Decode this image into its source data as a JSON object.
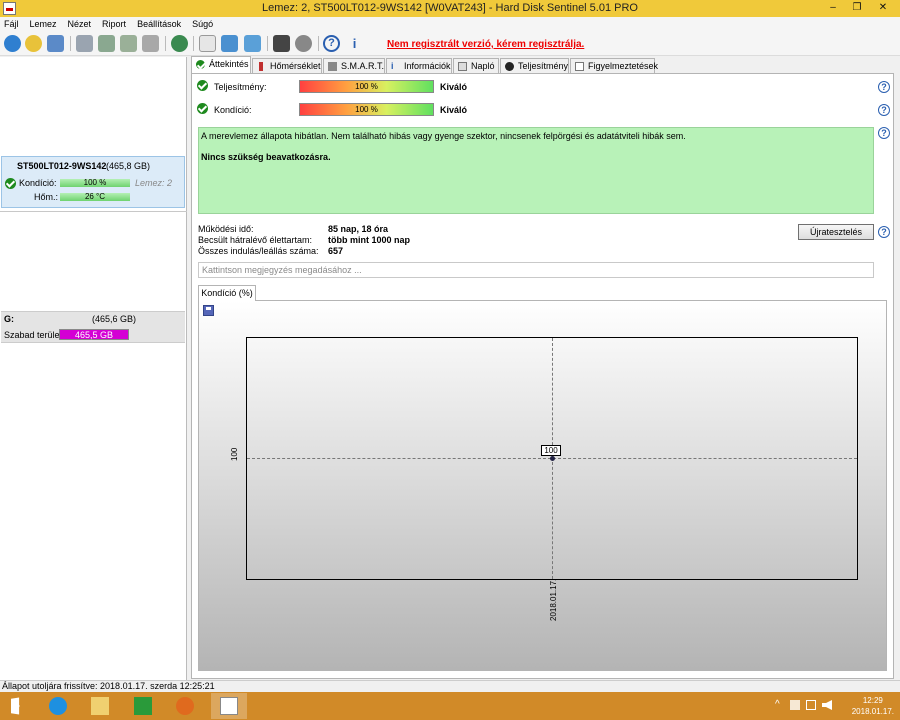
{
  "window": {
    "title": "Lemez: 2, ST500LT012-9WS142 [W0VAT243]  -  Hard Disk Sentinel 5.01 PRO",
    "minimize": "–",
    "maximize": "❐",
    "close": "✕"
  },
  "menu": [
    "Fájl",
    "Lemez",
    "Nézet",
    "Riport",
    "Beállítások",
    "Súgó"
  ],
  "toolbar": {
    "unregistered_link": "Nem regisztrált verzió, kérem regisztrálja."
  },
  "left": {
    "disk": {
      "name": "ST500LT012-9WS142",
      "size": "(465,8 GB)",
      "health_label": "Kondíció:",
      "health_value": "100 %",
      "health_fraction": 1.0,
      "disk_index": "Lemez: 2",
      "temp_label": "Hőm.:",
      "temp_value": "26 °C"
    },
    "volume": {
      "letter": "G:",
      "size": "(465,6 GB)",
      "free_label": "Szabad terület",
      "free_value": "465,5 GB",
      "free_color": "#d400d4"
    }
  },
  "tabs": [
    {
      "label": "Áttekintés",
      "icon": "check-icon"
    },
    {
      "label": "Hőmérséklet",
      "icon": "thermometer-icon"
    },
    {
      "label": "S.M.A.R.T.",
      "icon": "smart-icon"
    },
    {
      "label": "Információk",
      "icon": "info-icon"
    },
    {
      "label": "Napló",
      "icon": "log-icon"
    },
    {
      "label": "Teljesítmény",
      "icon": "performance-icon"
    },
    {
      "label": "Figyelmeztetések",
      "icon": "alerts-icon"
    }
  ],
  "overview": {
    "performance_label": "Teljesítmény:",
    "performance_value": "100 %",
    "performance_fraction": 1.0,
    "performance_status": "Kiváló",
    "health_label": "Kondíció:",
    "health_value": "100 %",
    "health_fraction": 1.0,
    "health_status": "Kiváló",
    "status_text": "A merevlemez állapota hibátlan. Nem található hibás vagy gyenge szektor, nincsenek felpörgési és adatátviteli hibák sem.",
    "status_action": "Nincs szükség beavatkozásra.",
    "uptime_label": "Működési idő:",
    "uptime_value": "85 nap, 18 óra",
    "lifetime_label": "Becsült hátralévő élettartam:",
    "lifetime_value": "több mint 1000 nap",
    "startstop_label": "Összes indulás/leállás száma:",
    "startstop_value": "657",
    "retest_button": "Újratesztelés",
    "notes_placeholder": "Kattintson megjegyzés megadásához ..."
  },
  "chart_tab": "Kondíció  (%)",
  "chart_data": {
    "type": "line",
    "x": [
      "2018.01.17."
    ],
    "series": [
      {
        "values": [
          100
        ]
      }
    ],
    "ytick_labels": [
      "100"
    ],
    "xtick_labels": [
      "2018.01.17."
    ],
    "data_labels": [
      "100"
    ],
    "grid": true
  },
  "statusbar": "Állapot utoljára frissítve: 2018.01.17. szerda 12:25:21",
  "taskbar": {
    "time": "12:29",
    "date": "2018.01.17.",
    "color": "#d18a28"
  }
}
